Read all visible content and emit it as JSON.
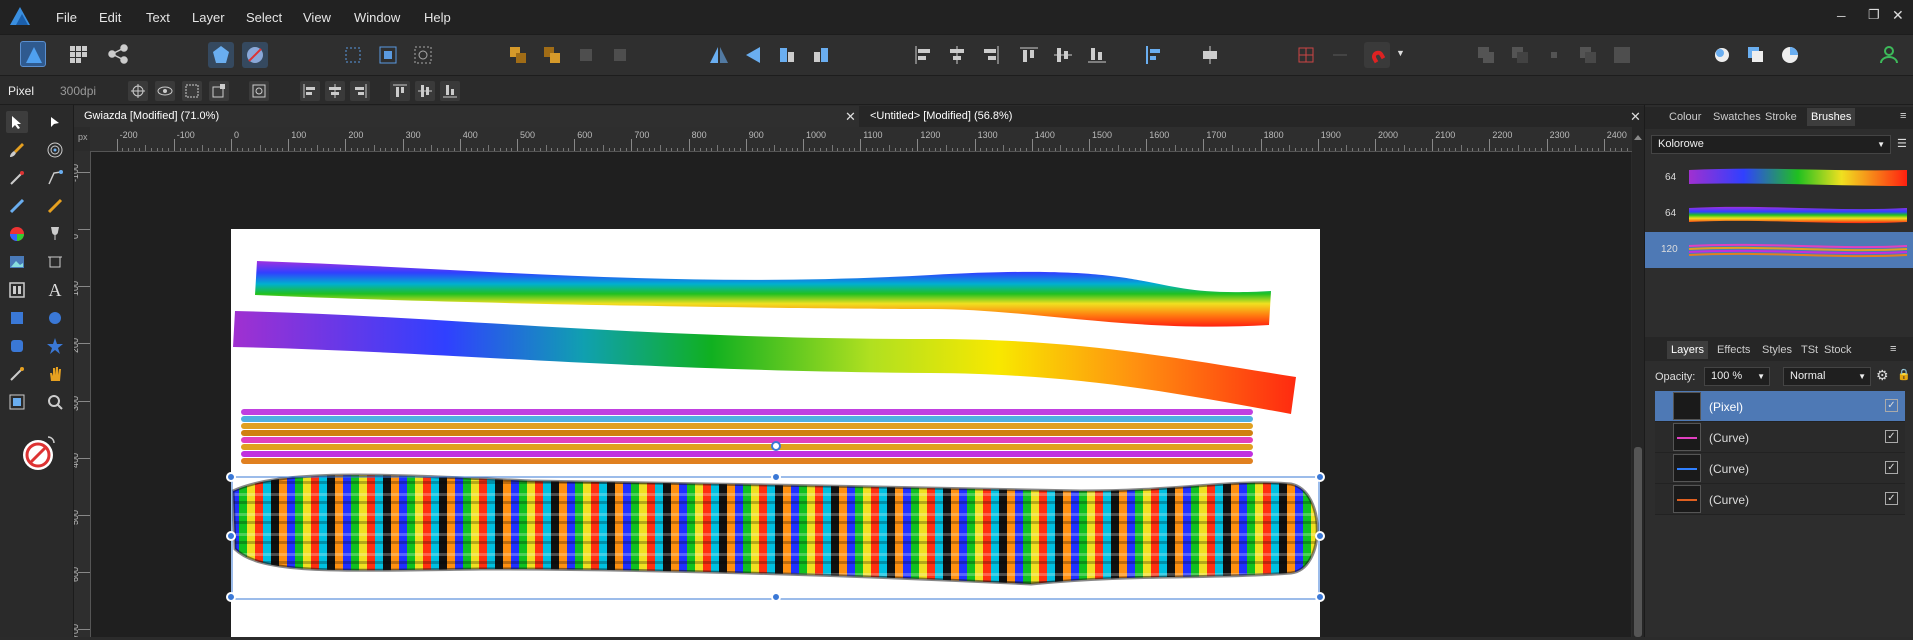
{
  "menubar": {
    "items": [
      "File",
      "Edit",
      "Text",
      "Layer",
      "Select",
      "View",
      "Window",
      "Help"
    ],
    "window_controls": {
      "minimize": "─",
      "restore": "❐",
      "close": "✕"
    }
  },
  "context": {
    "persona": "Pixel",
    "dpi": "300dpi"
  },
  "tabs": [
    {
      "title": "Gwiazda [Modified] (71.0%)",
      "close": "✕",
      "active": true
    },
    {
      "title": "<Untitled> [Modified] (56.8%)",
      "close": "✕",
      "active": false
    }
  ],
  "ruler": {
    "unit": "px",
    "h_labels": [
      "-200",
      "-100",
      "0",
      "100",
      "200",
      "300",
      "400",
      "500",
      "600",
      "700",
      "800",
      "900",
      "1000",
      "1100",
      "1200",
      "1300",
      "1400",
      "1500",
      "1600",
      "1700",
      "1800",
      "1900",
      "2000",
      "2100",
      "2200",
      "2300",
      "2400"
    ],
    "v_labels": [
      "-100",
      "0",
      "100",
      "200",
      "300",
      "400",
      "500",
      "600",
      "700"
    ]
  },
  "brushes_panel": {
    "tabs": [
      "Colour",
      "Swatches",
      "Stroke",
      "Brushes"
    ],
    "active_tab": "Brushes",
    "category": "Kolorowe",
    "brushes": [
      {
        "size": "64"
      },
      {
        "size": "64"
      },
      {
        "size": "120",
        "selected": true
      }
    ]
  },
  "layers_panel": {
    "tabs": [
      "Layers",
      "Effects",
      "Styles",
      "TSt",
      "Stock"
    ],
    "active_tab": "Layers",
    "opacity_label": "Opacity:",
    "opacity_value": "100 %",
    "blend_mode": "Normal",
    "layers": [
      {
        "name": "(Pixel)",
        "selected": true,
        "visible_check": "✓"
      },
      {
        "name": "(Curve)",
        "selected": false,
        "visible_check": "✓"
      },
      {
        "name": "(Curve)",
        "selected": false,
        "visible_check": "✓"
      },
      {
        "name": "(Curve)",
        "selected": false,
        "visible_check": "✓"
      }
    ]
  },
  "icons": {
    "app": "affinity-photo-icon",
    "share": "share-icon",
    "grid": "grid-icon",
    "tools": [
      "move-icon",
      "node-icon",
      "paint-brush-icon",
      "target-icon",
      "pen-icon",
      "crop-icon",
      "pencil-icon",
      "color-brush-icon",
      "color-wheel-icon",
      "wine-glass-icon",
      "image-icon",
      "crop-frame-icon",
      "frame-text-icon",
      "text-icon",
      "rectangle-icon",
      "ellipse-icon",
      "rounded-rect-icon",
      "star-icon",
      "eyedropper-icon",
      "hand-icon",
      "vector-crop-icon",
      "zoom-icon"
    ]
  },
  "colors": {
    "accent": "#3a78d6",
    "selection": "#4e79b5",
    "background": "#1f1f1f"
  }
}
